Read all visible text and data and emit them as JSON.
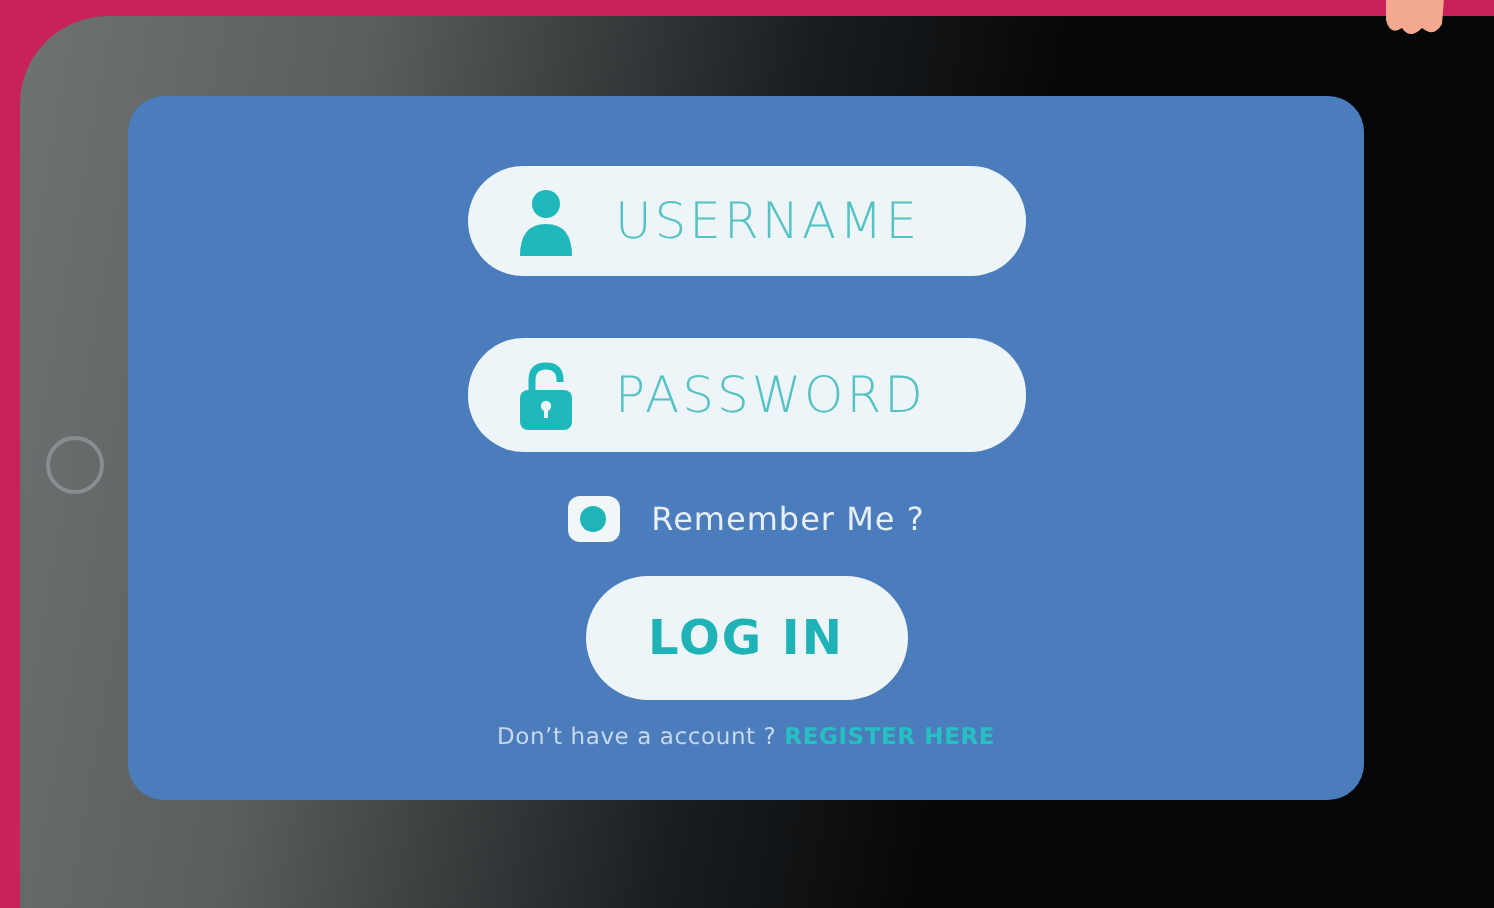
{
  "username": {
    "placeholder": "USERNAME"
  },
  "password": {
    "placeholder": "PASSWORD"
  },
  "remember": {
    "label": "Remember Me ?",
    "checked": true
  },
  "login_button": "LOG IN",
  "signup": {
    "text": "Don’t have a account ?",
    "link": "REGISTER HERE"
  }
}
